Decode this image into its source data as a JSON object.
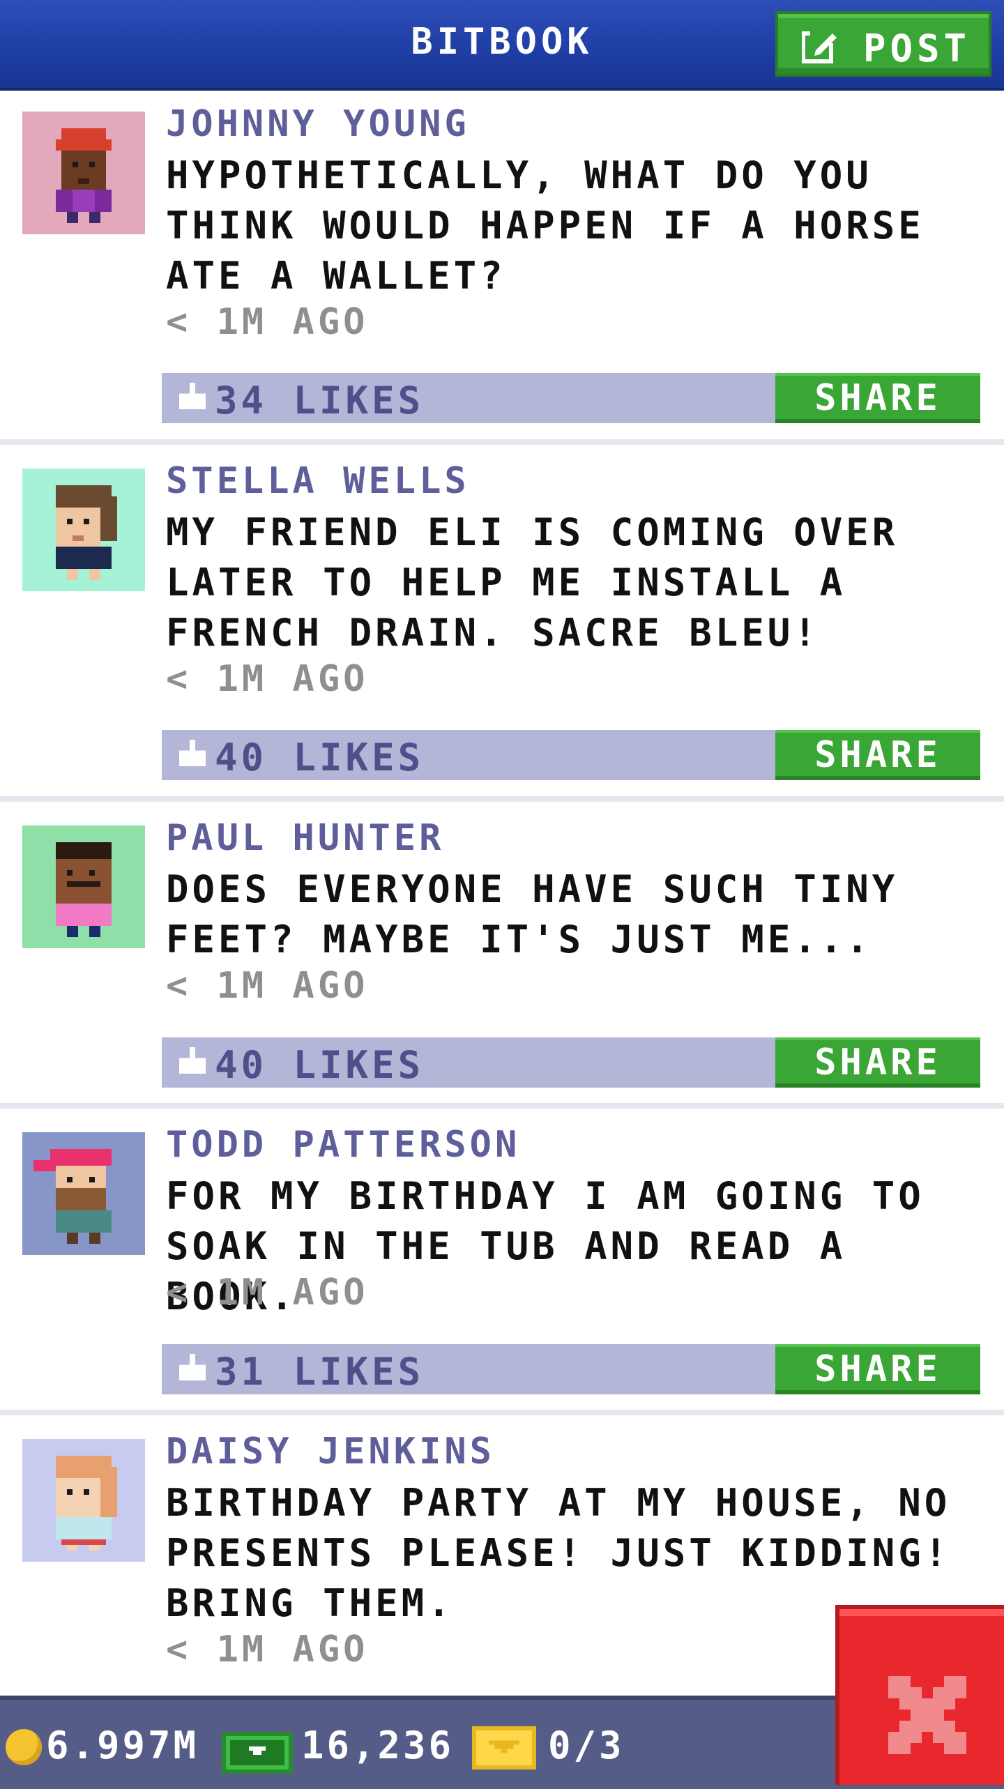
{
  "header": {
    "title": "BITBOOK",
    "post_label": "POST"
  },
  "posts": [
    {
      "name": "JOHNNY YOUNG",
      "message": "HYPOTHETICALLY, WHAT DO YOU THINK WOULD HAPPEN IF A HORSE ATE A WALLET?",
      "time": "< 1M AGO",
      "likes": "34 LIKES",
      "share_label": "SHARE",
      "avatar_bg": "#e3a8bb"
    },
    {
      "name": "STELLA WELLS",
      "message": "MY FRIEND ELI IS COMING OVER LATER TO HELP ME INSTALL A FRENCH DRAIN. SACRE BLEU!",
      "time": "< 1M AGO",
      "likes": "40 LIKES",
      "share_label": "SHARE",
      "avatar_bg": "#a6f2d7"
    },
    {
      "name": "PAUL HUNTER",
      "message": "DOES EVERYONE HAVE SUCH TINY FEET? MAYBE IT'S JUST ME...",
      "time": "< 1M AGO",
      "likes": "40 LIKES",
      "share_label": "SHARE",
      "avatar_bg": "#8edfa8"
    },
    {
      "name": "TODD PATTERSON",
      "message": "FOR MY BIRTHDAY I AM GOING TO SOAK IN THE TUB AND READ A BOOK.",
      "time": "< 1M AGO",
      "likes": "31 LIKES",
      "share_label": "SHARE",
      "avatar_bg": "#8696c8"
    },
    {
      "name": "DAISY JENKINS",
      "message": "BIRTHDAY PARTY AT MY HOUSE, NO PRESENTS PLEASE! JUST KIDDING! BRING THEM.",
      "time": "< 1M AGO",
      "avatar_bg": "#c8cbf0"
    }
  ],
  "status": {
    "coins": "6.997M",
    "bux": "16,236",
    "vip": "0/3"
  },
  "icons": {
    "post": "edit-icon",
    "like": "thumbs-up-icon",
    "coin": "coin-icon",
    "bux": "bux-icon",
    "vip": "vip-ticket-icon",
    "close": "close-icon"
  },
  "colors": {
    "header": "#1f3fa6",
    "button_green": "#3aa635",
    "like_bar": "#b4b6d8",
    "name": "#5e5e9a",
    "close_red": "#e8282c"
  }
}
